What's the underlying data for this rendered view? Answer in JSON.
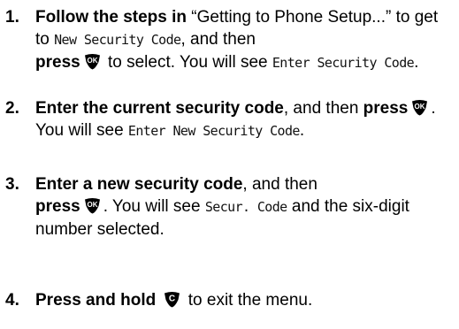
{
  "steps": [
    {
      "number": "1.",
      "bold_1": "Follow the steps in",
      "text_1": " “Getting to Phone Setup...” to get to ",
      "lcd_1": "New Security Code",
      "text_2": ", and then ",
      "bold_2": "press",
      "key": "ok-key-icon",
      "text_3": " to select. You will see ",
      "lcd_2": "Enter Security Code",
      "text_4": "."
    },
    {
      "number": "2.",
      "bold_1": "Enter the current security code",
      "text_1": ", and then ",
      "bold_2": "press",
      "key": "ok-key-icon",
      "text_2": ". You will see ",
      "lcd_1": "Enter New Security Code",
      "text_3": "."
    },
    {
      "number": "3.",
      "bold_1": "Enter a new security code",
      "text_1": ", and then ",
      "bold_2": "press",
      "key": "ok-key-icon",
      "text_2": ". You will see ",
      "lcd_1": "Secur. Code",
      "text_3": " and the six-digit number selected."
    },
    {
      "number": "4.",
      "bold_1": "Press and hold",
      "key": "clear-key-icon",
      "text_1": " to exit the menu."
    }
  ],
  "keys": {
    "ok_label": "OK",
    "clear_label": "C",
    "fill_color": "#000000",
    "label_color": "#ffffff"
  }
}
